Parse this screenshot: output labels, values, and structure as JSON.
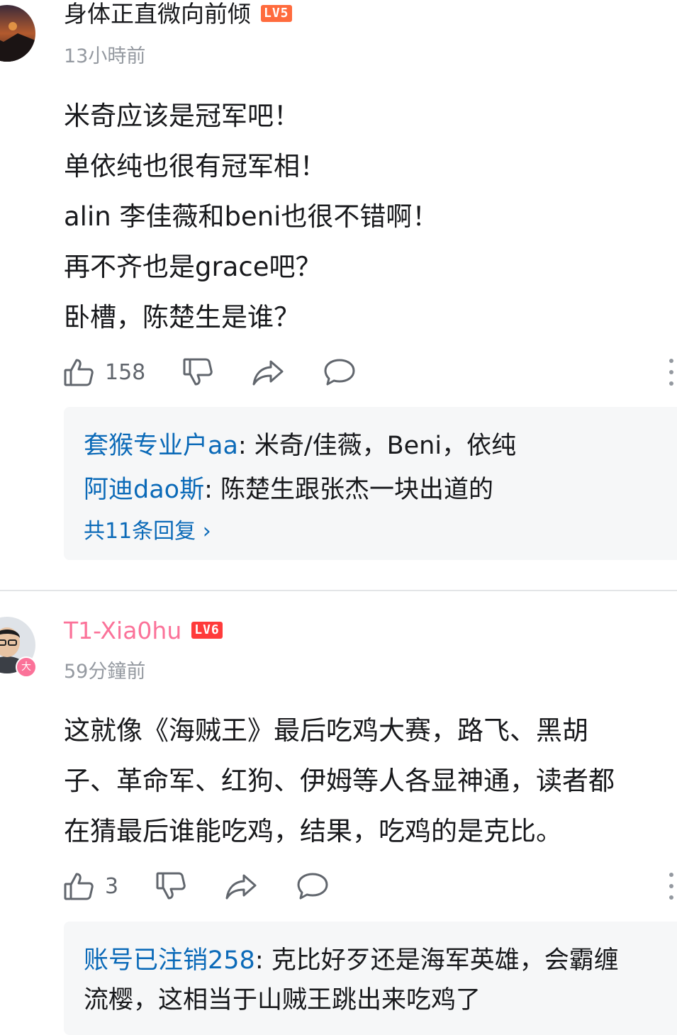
{
  "comments": [
    {
      "username": "身体正直微向前倾",
      "level": "LV5",
      "level_color": "#ff6b3d",
      "username_color": "#18191c",
      "time": "13小時前",
      "content_lines": [
        "米奇应该是冠军吧！",
        "单依纯也很有冠军相！",
        "alin 李佳薇和beni也很不错啊！",
        "再不齐也是grace吧？",
        "卧槽，陈楚生是谁？"
      ],
      "like_count": "158",
      "replies": [
        {
          "name": "套猴专业户aa",
          "sep": ": ",
          "text": "米奇/佳薇，Beni，依纯"
        },
        {
          "name": "阿迪dao斯",
          "sep": ": ",
          "text": "陈楚生跟张杰一块出道的"
        }
      ],
      "replies_total": "共11条回复 ›"
    },
    {
      "username": "T1-Xia0hu",
      "level": "LV6",
      "level_color": "#ff3b3b",
      "username_color": "#fb7299",
      "avatar_badge": "大",
      "time": "59分鐘前",
      "content_lines": [
        "这就像《海贼王》最后吃鸡大赛，路飞、黑胡",
        "子、革命军、红狗、伊姆等人各显神通，读者都",
        "在猜最后谁能吃鸡，结果，吃鸡的是克比。"
      ],
      "like_count": "3",
      "replies": [
        {
          "name": "账号已注销258",
          "sep": ": ",
          "text": "克比好歹还是海军英雄，会霸缠",
          "text2": "流樱，这相当于山贼王跳出来吃鸡了"
        }
      ]
    }
  ],
  "icons": [
    "thumb-up-icon",
    "thumb-down-icon",
    "share-icon",
    "reply-bubble-icon",
    "more-dots-icon"
  ]
}
